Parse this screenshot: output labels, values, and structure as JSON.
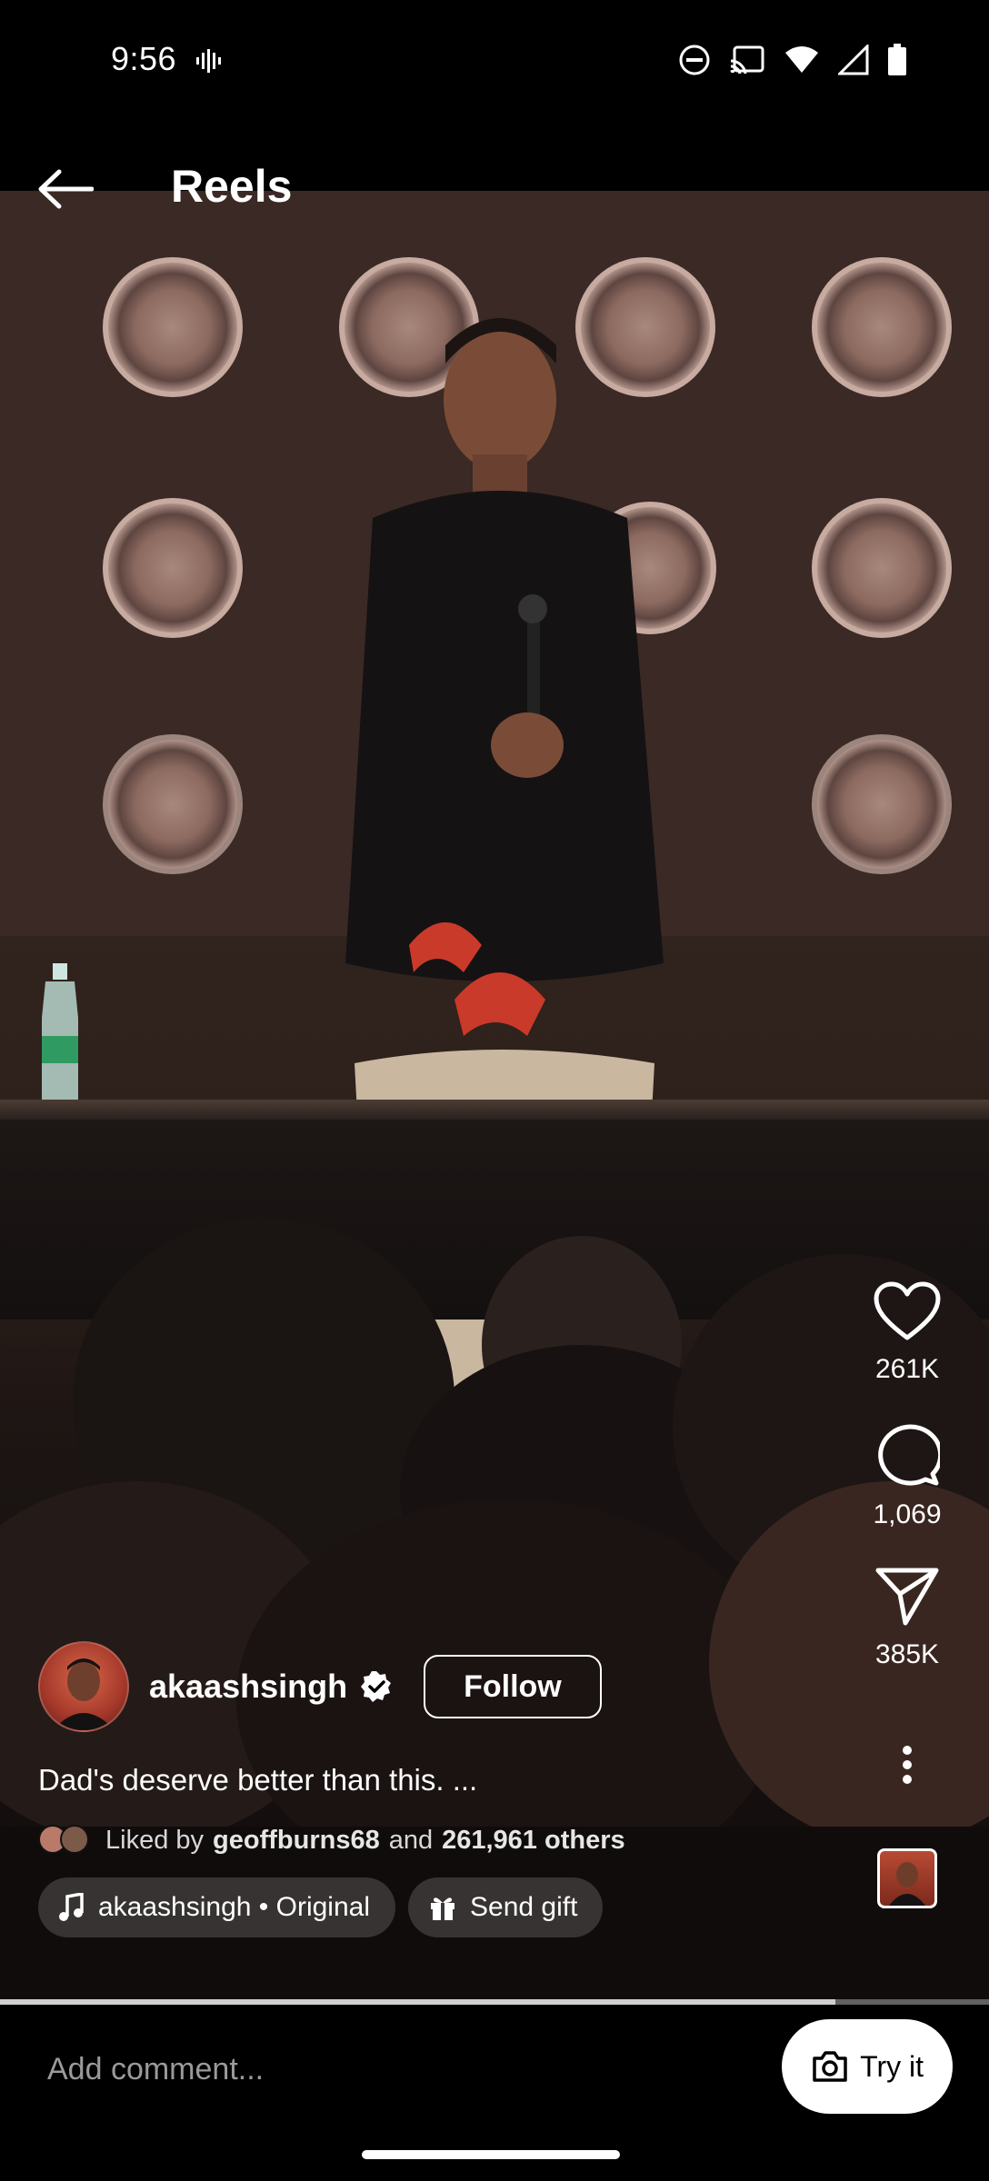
{
  "status_bar": {
    "time": "9:56"
  },
  "header": {
    "title": "Reels"
  },
  "rail": {
    "likes": "261K",
    "comments": "1,069",
    "shares": "385K"
  },
  "post": {
    "username": "akaashsingh",
    "follow_label": "Follow",
    "caption": "Dad's deserve better than this. ...",
    "liked_prefix": "Liked by",
    "liked_user": "geoffburns68",
    "liked_and": "and",
    "liked_others": "261,961 others",
    "audio_label": "akaashsingh • Original",
    "gift_label": "Send gift"
  },
  "progress": {
    "fraction": 0.845
  },
  "comment_bar": {
    "placeholder": "Add comment...",
    "try_label": "Try it"
  },
  "icons": [
    "back-arrow-icon",
    "heart-icon",
    "comment-icon",
    "send-icon",
    "more-vertical-icon",
    "music-note-icon",
    "gift-icon",
    "camera-icon",
    "verified-icon"
  ]
}
